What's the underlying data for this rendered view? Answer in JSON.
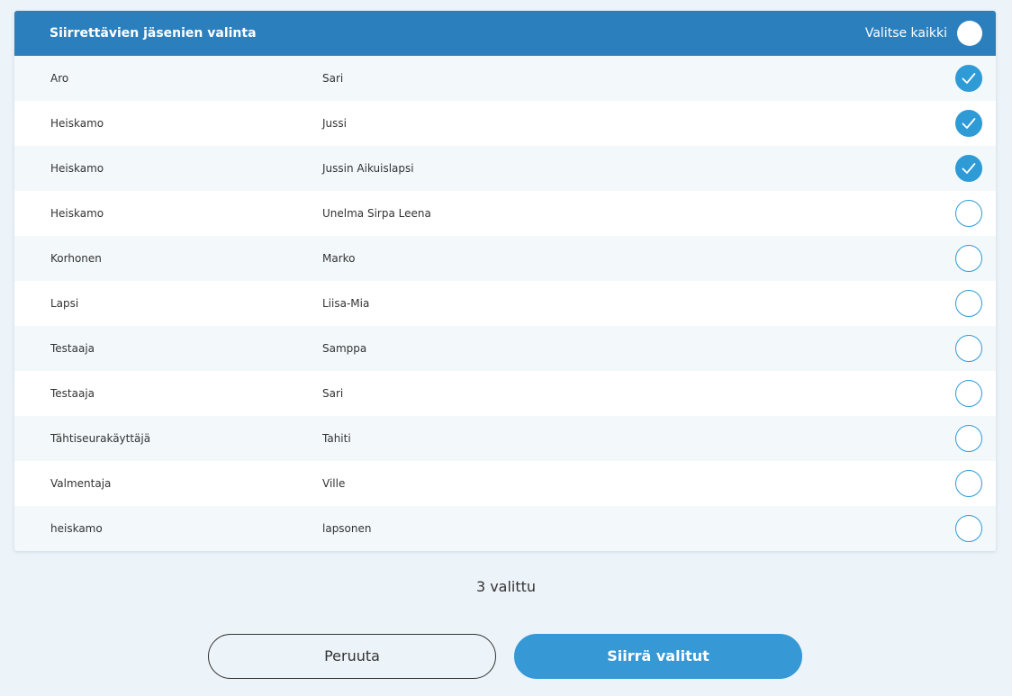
{
  "header": {
    "title": "Siirrettävien jäsenien valinta",
    "select_all_label": "Valitse kaikki"
  },
  "rows": [
    {
      "last_name": "Aro",
      "first_name": "Sari",
      "selected": true
    },
    {
      "last_name": "Heiskamo",
      "first_name": "Jussi",
      "selected": true
    },
    {
      "last_name": "Heiskamo",
      "first_name": "Jussin Aikuislapsi",
      "selected": true
    },
    {
      "last_name": "Heiskamo",
      "first_name": "Unelma Sirpa Leena",
      "selected": false
    },
    {
      "last_name": "Korhonen",
      "first_name": "Marko",
      "selected": false
    },
    {
      "last_name": "Lapsi",
      "first_name": "Liisa-Mia",
      "selected": false
    },
    {
      "last_name": "Testaaja",
      "first_name": "Samppa",
      "selected": false
    },
    {
      "last_name": "Testaaja",
      "first_name": "Sari",
      "selected": false
    },
    {
      "last_name": "Tähtiseurakäyttäjä",
      "first_name": "Tahiti",
      "selected": false
    },
    {
      "last_name": "Valmentaja",
      "first_name": "Ville",
      "selected": false
    },
    {
      "last_name": "heiskamo",
      "first_name": "lapsonen",
      "selected": false
    }
  ],
  "selection_count": "3 valittu",
  "buttons": {
    "cancel_label": "Peruuta",
    "submit_label": "Siirrä valitut"
  },
  "colors": {
    "header_bg": "#2a7fbc",
    "accent": "#2e9ad6",
    "page_bg": "#edf4f9"
  },
  "icons": {
    "selected": "checkmark-icon",
    "unselected": "empty-circle-icon"
  }
}
